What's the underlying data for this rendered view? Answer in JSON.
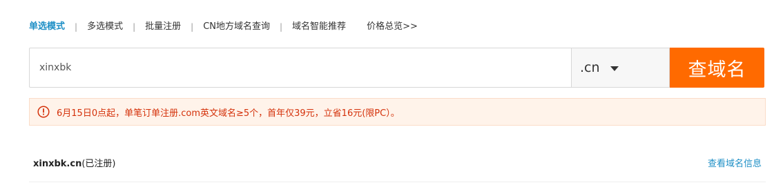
{
  "mode_tabs": {
    "single": "单选模式",
    "multi": "多选模式",
    "batch": "批量注册",
    "cn_regional": "CN地方域名查询",
    "smart_recommend": "域名智能推荐",
    "separator": "|",
    "price_overview": "价格总览>>"
  },
  "search": {
    "value": "xinxbk",
    "suffix": ".cn",
    "button_label": "查域名"
  },
  "notice": {
    "text": "6月15日0点起，单笔订单注册.com英文域名≥5个，首年仅39元，立省16元(限PC）。"
  },
  "result": {
    "domain": "xinxbk.cn",
    "status": "(已注册)",
    "action": "查看域名信息"
  },
  "colors": {
    "accent_blue": "#1e8fc6",
    "brand_orange": "#ff6a00",
    "notice_red": "#d4310a",
    "notice_bg": "#fff3ea"
  }
}
